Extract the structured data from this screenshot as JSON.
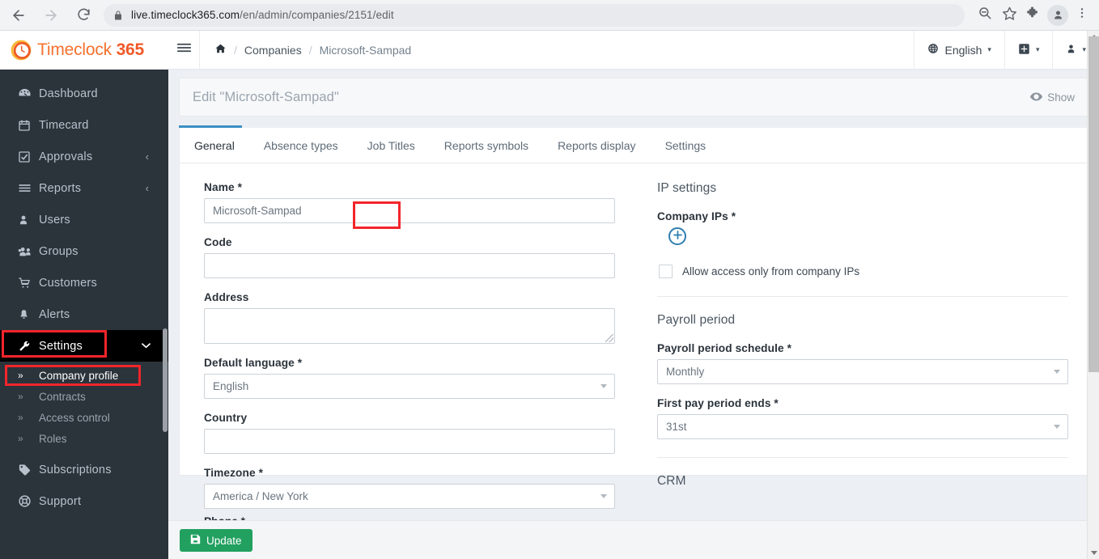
{
  "browser": {
    "url_domain": "live.timeclock365.com",
    "url_path": "/en/admin/companies/2151/edit",
    "back_icon": "arrow-left-icon",
    "forward_icon": "arrow-right-icon",
    "reload_icon": "reload-icon",
    "lock_icon": "lock-icon",
    "zoom_icon": "zoom-out-icon",
    "bookmark_icon": "star-icon",
    "extensions_icon": "puzzle-icon",
    "profile_icon": "person-icon",
    "menu_icon": "three-dots-vertical-icon"
  },
  "brand": {
    "name": "Timeclock",
    "suffix": "365",
    "logo_icon": "clock-logo-icon",
    "accent": "#f05a28"
  },
  "sidebar": {
    "items": [
      {
        "label": "Dashboard",
        "icon": "dashboard-gauge-icon",
        "expandable": false
      },
      {
        "label": "Timecard",
        "icon": "calendar-icon",
        "expandable": false
      },
      {
        "label": "Approvals",
        "icon": "check-square-icon",
        "expandable": true,
        "caret": "‹"
      },
      {
        "label": "Reports",
        "icon": "bars-icon",
        "expandable": true,
        "caret": "‹"
      },
      {
        "label": "Users",
        "icon": "user-icon",
        "expandable": false
      },
      {
        "label": "Groups",
        "icon": "users-group-icon",
        "expandable": false
      },
      {
        "label": "Customers",
        "icon": "shopping-cart-icon",
        "expandable": false
      },
      {
        "label": "Alerts",
        "icon": "bell-icon",
        "expandable": false
      }
    ],
    "settings": {
      "label": "Settings",
      "icon": "wrench-icon",
      "expanded": true,
      "chevron": "chevron-down-icon",
      "highlighted": true
    },
    "sub_items": [
      {
        "label": "Company profile",
        "bullet": "»",
        "active": true,
        "highlighted": true
      },
      {
        "label": "Contracts",
        "bullet": "»",
        "active": false
      },
      {
        "label": "Access control",
        "bullet": "»",
        "active": false
      },
      {
        "label": "Roles",
        "bullet": "»",
        "active": false
      }
    ],
    "tail_items": [
      {
        "label": "Subscriptions",
        "icon": "tag-icon"
      },
      {
        "label": "Support",
        "icon": "life-ring-icon"
      }
    ],
    "highlight_color": "#f3252b"
  },
  "topbar": {
    "menu_toggle_icon": "hamburger-icon",
    "home_icon": "home-icon",
    "breadcrumb": {
      "sep": "/",
      "companies": "Companies",
      "current": "Microsoft-Sampad"
    },
    "language": {
      "label": "English",
      "icon": "globe-icon",
      "caret": "▾"
    },
    "add_menu": {
      "icon": "plus-square-icon",
      "caret": "▾"
    },
    "user_menu": {
      "icon": "user-icon",
      "caret": "▾"
    }
  },
  "panel": {
    "title": "Edit \"Microsoft-Sampad\"",
    "show_label": "Show",
    "show_icon": "eye-icon"
  },
  "tabs": [
    {
      "label": "General",
      "active": true,
      "highlighted": true
    },
    {
      "label": "Absence types",
      "active": false
    },
    {
      "label": "Job Titles",
      "active": false
    },
    {
      "label": "Reports symbols",
      "active": false
    },
    {
      "label": "Reports display",
      "active": false
    },
    {
      "label": "Settings",
      "active": false
    }
  ],
  "form": {
    "left": {
      "name": {
        "label": "Name *",
        "value": "Microsoft-Sampad",
        "placeholder": ""
      },
      "code": {
        "label": "Code",
        "value": "",
        "placeholder": ""
      },
      "address": {
        "label": "Address",
        "value": "",
        "placeholder": ""
      },
      "default_language": {
        "label": "Default language *",
        "value": "English",
        "options": [
          "English"
        ]
      },
      "country": {
        "label": "Country",
        "value": "",
        "placeholder": ""
      },
      "timezone": {
        "label": "Timezone *",
        "value": "America / New York",
        "options": [
          "America / New York"
        ]
      },
      "phone_clipped": {
        "label": "Phone *"
      }
    },
    "right": {
      "ip_settings": {
        "section_title": "IP settings",
        "company_ips_label": "Company IPs *",
        "add_icon": "plus-circle-icon",
        "add_icon_color": "#2e7eb1",
        "checkbox": {
          "label": "Allow access only from company IPs",
          "checked": false
        }
      },
      "payroll": {
        "section_title": "Payroll period",
        "schedule": {
          "label": "Payroll period schedule *",
          "value": "Monthly",
          "options": [
            "Monthly"
          ]
        },
        "first_period_end": {
          "label": "First pay period ends *",
          "value": "31st",
          "options": [
            "31st"
          ]
        }
      },
      "crm": {
        "section_title": "CRM"
      }
    }
  },
  "footer": {
    "update_label": "Update",
    "update_icon": "save-floppy-icon",
    "update_color": "#22a060"
  },
  "scrollbars": {
    "page_scroll_thumb_top_pct": 1,
    "sidebar_scroll_visible": true
  }
}
